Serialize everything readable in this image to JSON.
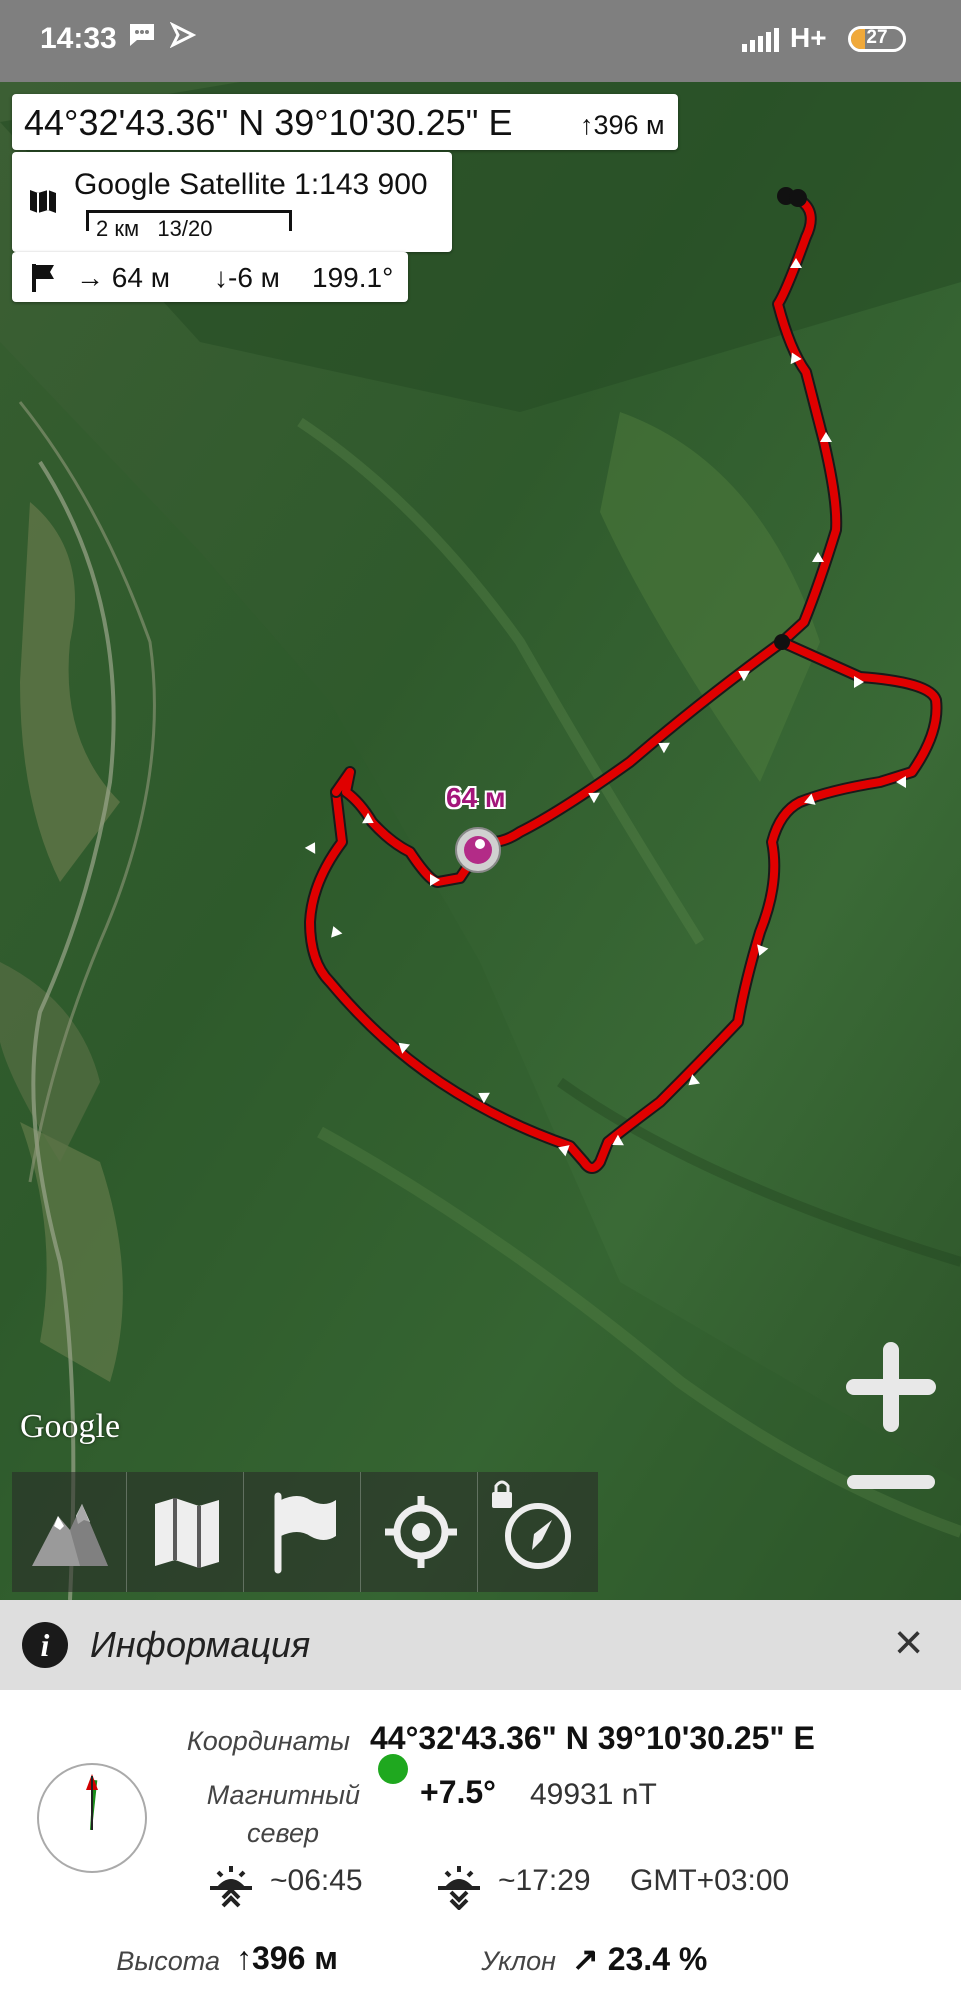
{
  "status_bar": {
    "time": "14:33",
    "network": "H+",
    "battery": "27",
    "battery_level": 0.27,
    "notification_icons": [
      "message-icon",
      "navigation-icon"
    ]
  },
  "map": {
    "coordinates": "44°32'43.36\" N 39°10'30.25\" E",
    "altitude": "↑396 м",
    "layer_name": "Google Satellite 1:143 900",
    "scale_text": "2 км   13/20",
    "nav_distance": "→ 64 м",
    "nav_drop": "↓-6 м",
    "nav_bearing": "199.1°",
    "track_label": "64 м",
    "provider_logo": "Google",
    "track_color": "#e00000",
    "toolbar": [
      {
        "name": "terrain",
        "icon": "mountain-icon"
      },
      {
        "name": "maps",
        "icon": "map-icon"
      },
      {
        "name": "waypoints",
        "icon": "flag-icon"
      },
      {
        "name": "locate",
        "icon": "crosshair-icon"
      },
      {
        "name": "compass",
        "icon": "compass-icon",
        "locked": true
      }
    ],
    "zoom_in": "+",
    "zoom_out": "−"
  },
  "info": {
    "title": "Информация",
    "close": "×",
    "coords_label": "Координаты",
    "coords_value": "44°32'43.36\" N 39°10'30.25\" E",
    "magnetic_label_1": "Магнитный",
    "magnetic_label_2": "север",
    "declination": "+7.5°",
    "field": "49931 nT",
    "sunrise": "~06:45",
    "sunset": "~17:29",
    "timezone": "GMT+03:00",
    "altitude_label": "Высота",
    "altitude_value": "↑396 м",
    "slope_label": "Уклон",
    "slope_value": "↗ 23.4 %"
  }
}
